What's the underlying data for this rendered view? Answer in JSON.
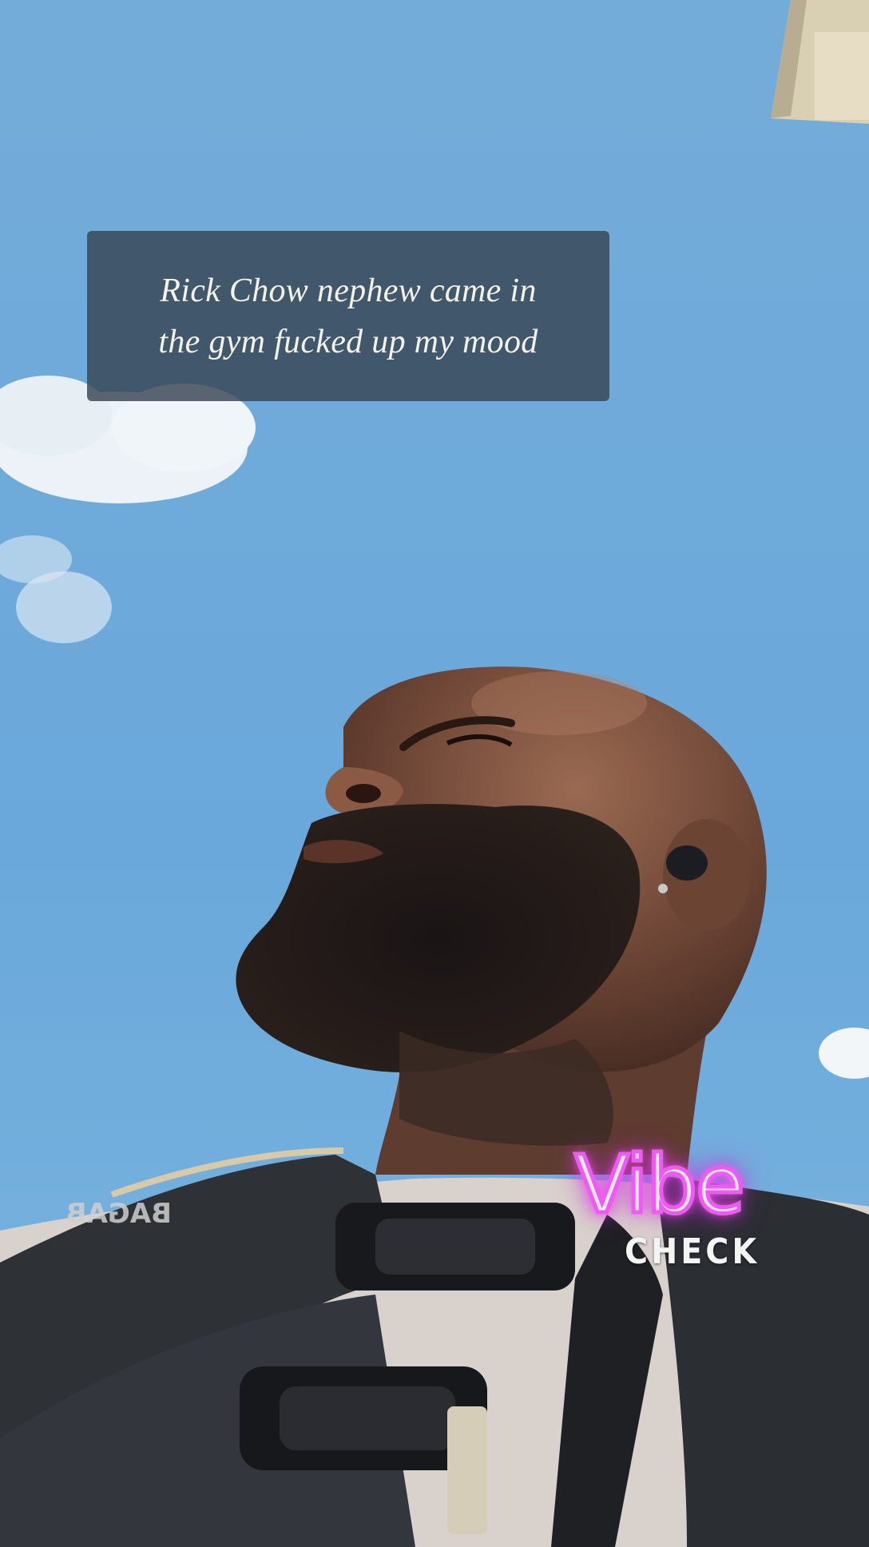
{
  "caption": {
    "lines": [
      "Rick Chow nephew came in",
      "the gym fucked up my mood"
    ]
  },
  "logo": {
    "script": "Vibe",
    "sub": "CHECK"
  },
  "strap_text": "BAGAB",
  "colors": {
    "sky": "#6fa8d6",
    "caption_bg": "#374452",
    "neon": "#ec5cf2"
  }
}
